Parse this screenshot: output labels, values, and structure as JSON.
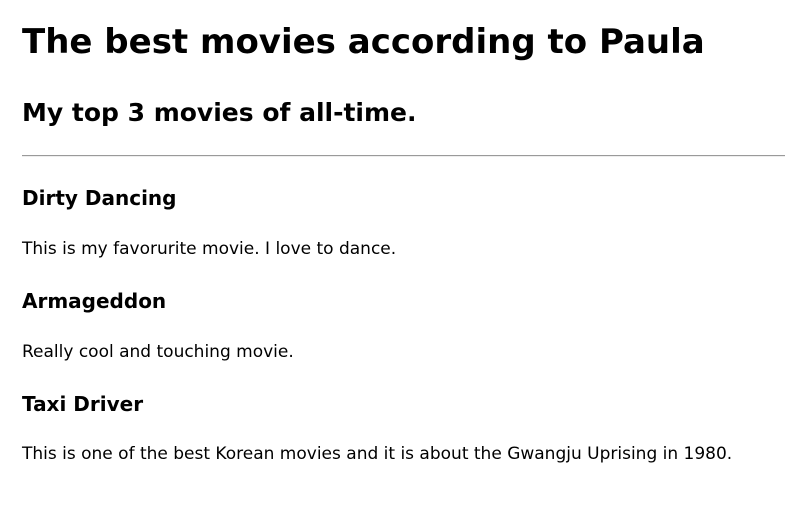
{
  "page": {
    "title": "The best movies according to Paula",
    "subtitle": "My top 3 movies of all-time."
  },
  "movies": [
    {
      "title": "Dirty Dancing",
      "description": "This is my favorurite movie. I love to dance."
    },
    {
      "title": "Armageddon",
      "description": "Really cool and touching movie."
    },
    {
      "title": "Taxi Driver",
      "description": "This is one of the best Korean movies and it is about the Gwangju Uprising in 1980."
    }
  ]
}
